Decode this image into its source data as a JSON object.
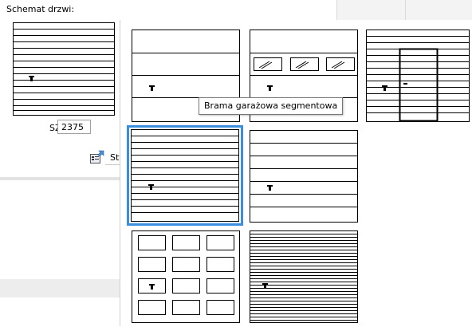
{
  "panel": {
    "title": "Schemat drzwi:",
    "sz_label": "SZ",
    "sz_value": "2375",
    "style_button_label": "Sty"
  },
  "gallery": {
    "tooltip": "Brama garażowa segmentowa",
    "selected_index": 4,
    "items": [
      {
        "type": "segmented-4-panels"
      },
      {
        "type": "segmented-with-windows"
      },
      {
        "type": "narrow-slats-with-wicket-door"
      },
      {
        "type": "narrow-slats"
      },
      {
        "type": "wide-slats"
      },
      {
        "type": "cassette-panels"
      },
      {
        "type": "micro-slats"
      }
    ]
  },
  "icons": {
    "handle": "handle-icon",
    "style": "style-settings-icon"
  }
}
